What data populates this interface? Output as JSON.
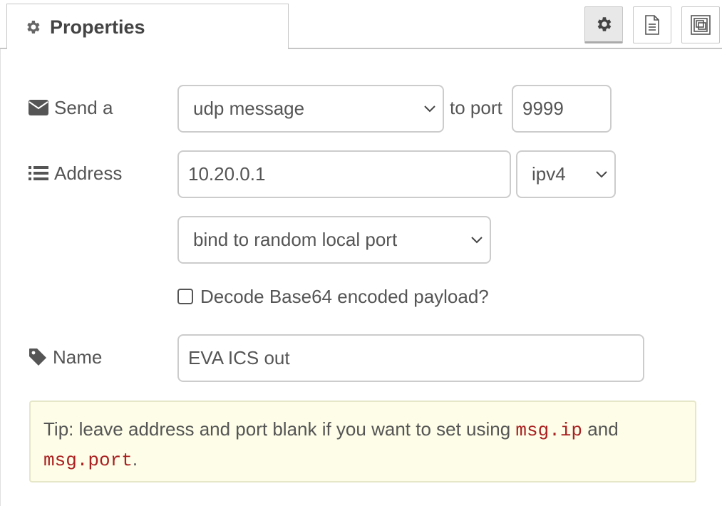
{
  "tab": {
    "label": "Properties"
  },
  "toolbar": {
    "settings": "gear-icon",
    "description": "document-icon",
    "appearance": "frame-icon"
  },
  "form": {
    "send": {
      "label": "Send a",
      "type_value": "udp message",
      "to_port_label": "to port",
      "port_value": "9999"
    },
    "address": {
      "label": "Address",
      "value": "10.20.0.1",
      "ip_version": "ipv4"
    },
    "bind": {
      "value": "bind to random local port"
    },
    "base64": {
      "label": "Decode Base64 encoded payload?",
      "checked": false
    },
    "name": {
      "label": "Name",
      "value": "EVA ICS out"
    }
  },
  "tip": {
    "prefix": "Tip: leave address and port blank if you want to set using ",
    "code1": "msg.ip",
    "middle": " and",
    "code2": "msg.port",
    "suffix": "."
  },
  "colors": {
    "tip_bg": "#fdfde8",
    "code": "#aa2020",
    "border": "#cccccc"
  }
}
